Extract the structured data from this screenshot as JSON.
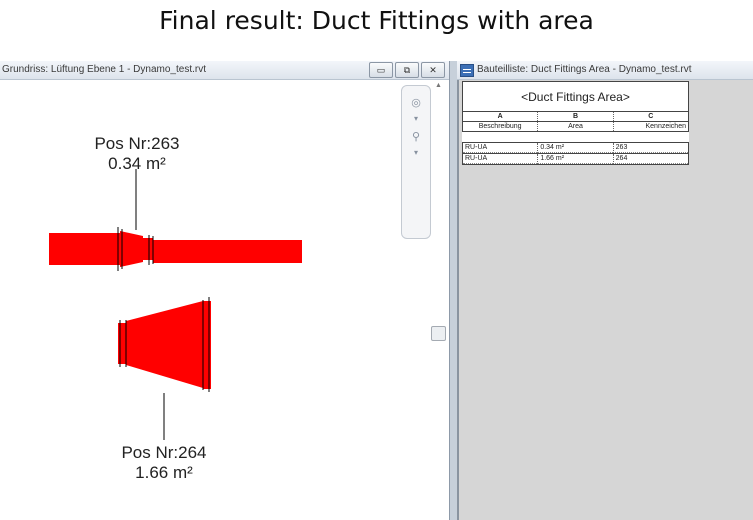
{
  "slide_title": "Final result: Duct Fittings with area",
  "left_window": {
    "title": "Grundriss: Lüftung Ebene 1 - Dynamo_test.rvt",
    "buttons": {
      "minimize": "▭",
      "restore": "⧉",
      "close": "✕"
    },
    "tags": [
      {
        "pos": "Pos Nr:263",
        "area": "0.34 m²"
      },
      {
        "pos": "Pos Nr:264",
        "area": "1.66 m²"
      }
    ],
    "fill_color": "#ff0000"
  },
  "right_window": {
    "title": "Bauteilliste: Duct Fittings Area - Dynamo_test.rvt",
    "schedule": {
      "name": "<Duct Fittings Area>",
      "column_letters": [
        "A",
        "B",
        "C"
      ],
      "column_headers": [
        "Beschreibung",
        "Area",
        "Kennzeichen"
      ],
      "rows": [
        [
          "RU-UA",
          "0.34 m²",
          "263"
        ],
        [
          "RU-UA",
          "1.66 m²",
          "264"
        ]
      ]
    }
  }
}
